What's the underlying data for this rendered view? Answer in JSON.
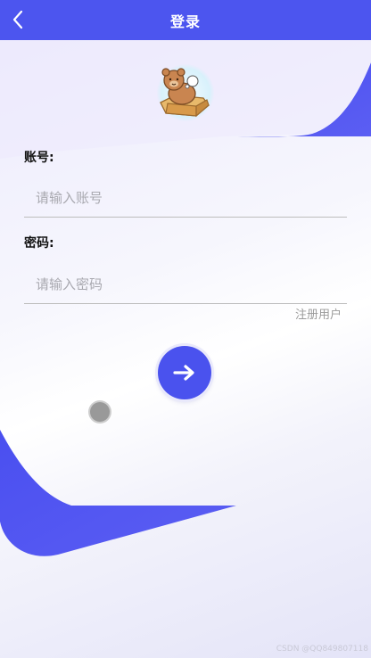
{
  "header": {
    "title": "登录",
    "back_icon": "chevron-left-icon"
  },
  "avatar": {
    "icon": "bear-in-box-avatar"
  },
  "form": {
    "account_label": "账号:",
    "account_placeholder": "请输入账号",
    "account_value": "",
    "password_label": "密码:",
    "password_placeholder": "请输入密码",
    "password_value": "",
    "register_link": "注册用户",
    "submit_icon": "arrow-right-icon"
  },
  "floating_button": {
    "icon": "assistive-touch-dot"
  },
  "watermark": "CSDN @QQ849807118",
  "colors": {
    "primary": "#4c55ef",
    "label": "#111111",
    "placeholder": "#a9a9b0",
    "link": "#9a9a9a"
  }
}
